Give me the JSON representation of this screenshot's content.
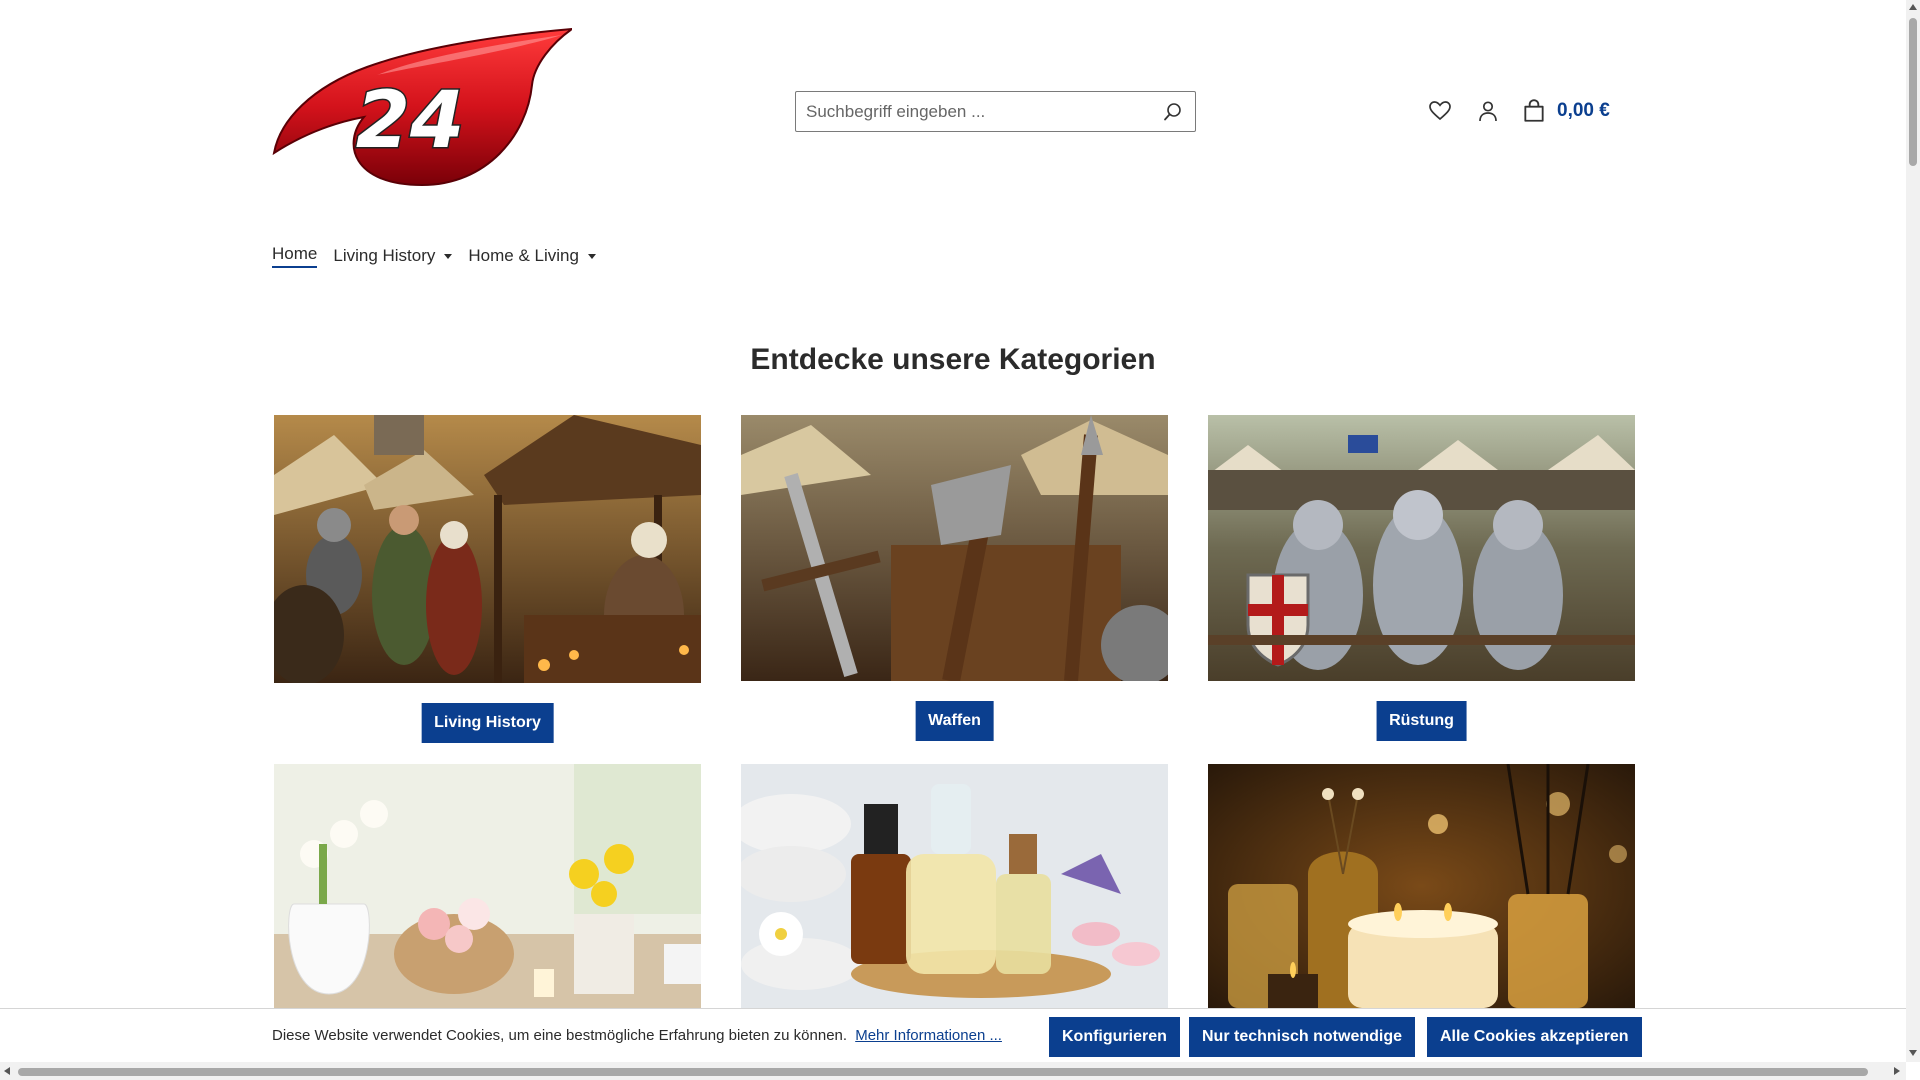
{
  "header": {
    "logo_text": "24",
    "search": {
      "placeholder": "Suchbegriff eingeben ..."
    },
    "cart_total": "0,00 €"
  },
  "nav": {
    "items": [
      {
        "label": "Home",
        "active": true
      },
      {
        "label": "Living History",
        "dropdown": true
      },
      {
        "label": "Home & Living",
        "dropdown": true
      }
    ]
  },
  "main": {
    "section_title": "Entdecke unsere Kategorien",
    "categories": [
      {
        "label": "Living History",
        "image": "medieval-market-photo"
      },
      {
        "label": "Waffen",
        "image": "weapons-photo"
      },
      {
        "label": "Rüstung",
        "image": "armored-knights-photo"
      },
      {
        "label": "",
        "image": "spring-flowers-photo"
      },
      {
        "label": "",
        "image": "essential-oils-photo"
      },
      {
        "label": "",
        "image": "candles-diffuser-photo"
      }
    ]
  },
  "cookie_bar": {
    "text": "Diese Website verwendet Cookies, um eine bestmögliche Erfahrung bieten zu können.",
    "more_info": "Mehr Informationen ...",
    "configure": "Konfigurieren",
    "necessary_only": "Nur technisch notwendige",
    "accept_all": "Alle Cookies akzeptieren"
  },
  "colors": {
    "primary": "#0b3f8f",
    "logo_red": "#d3121b"
  }
}
